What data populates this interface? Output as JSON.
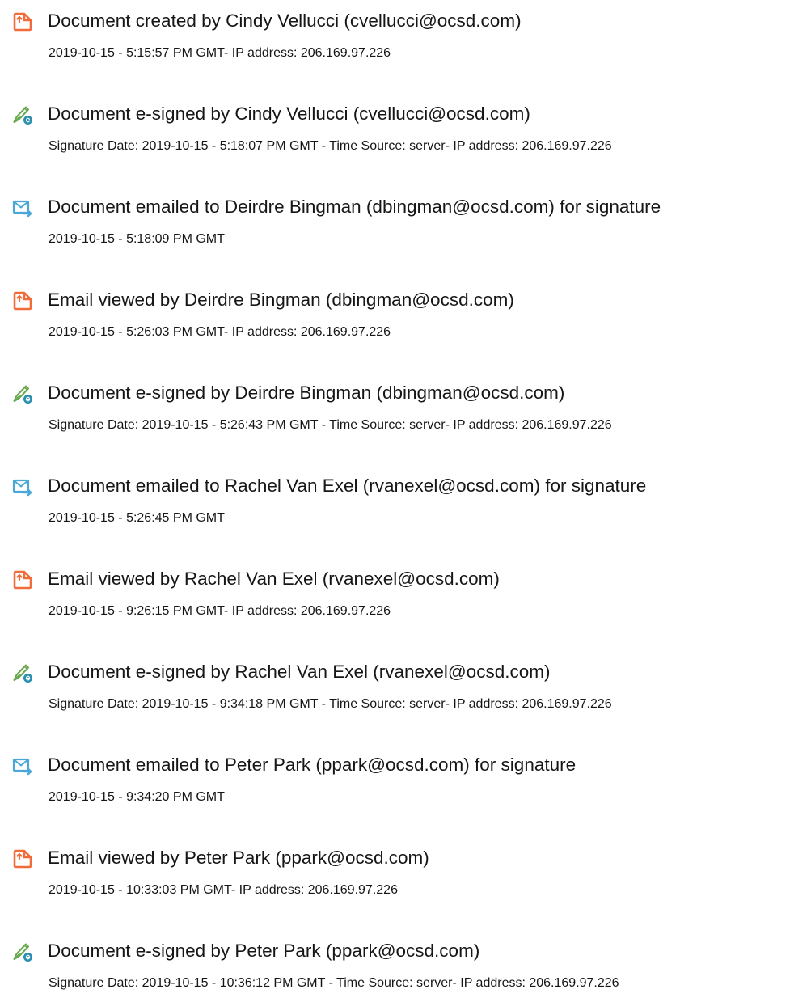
{
  "events": [
    {
      "type": "created",
      "icon": "document-created-icon",
      "title": "Document created by Cindy Vellucci (cvellucci@ocsd.com)",
      "detail": "2019-10-15 - 5:15:57 PM GMT- IP address: 206.169.97.226"
    },
    {
      "type": "signed",
      "icon": "e-sign-pen-icon",
      "title": "Document e-signed by Cindy Vellucci (cvellucci@ocsd.com)",
      "detail": "Signature Date: 2019-10-15 - 5:18:07 PM GMT - Time Source: server- IP address: 206.169.97.226"
    },
    {
      "type": "emailed",
      "icon": "envelope-send-icon",
      "title": "Document emailed to Deirdre Bingman (dbingman@ocsd.com) for signature",
      "detail": "2019-10-15 - 5:18:09 PM GMT"
    },
    {
      "type": "viewed",
      "icon": "document-viewed-icon",
      "title": "Email viewed by Deirdre Bingman (dbingman@ocsd.com)",
      "detail": "2019-10-15 - 5:26:03 PM GMT- IP address: 206.169.97.226"
    },
    {
      "type": "signed",
      "icon": "e-sign-pen-icon",
      "title": "Document e-signed by Deirdre Bingman (dbingman@ocsd.com)",
      "detail": "Signature Date: 2019-10-15 - 5:26:43 PM GMT - Time Source: server- IP address: 206.169.97.226"
    },
    {
      "type": "emailed",
      "icon": "envelope-send-icon",
      "title": "Document emailed to Rachel Van Exel (rvanexel@ocsd.com) for signature",
      "detail": "2019-10-15 - 5:26:45 PM GMT"
    },
    {
      "type": "viewed",
      "icon": "document-viewed-icon",
      "title": "Email viewed by Rachel Van Exel (rvanexel@ocsd.com)",
      "detail": "2019-10-15 - 9:26:15 PM GMT- IP address: 206.169.97.226"
    },
    {
      "type": "signed",
      "icon": "e-sign-pen-icon",
      "title": "Document e-signed by Rachel Van Exel (rvanexel@ocsd.com)",
      "detail": "Signature Date: 2019-10-15 - 9:34:18 PM GMT - Time Source: server- IP address: 206.169.97.226"
    },
    {
      "type": "emailed",
      "icon": "envelope-send-icon",
      "title": "Document emailed to Peter Park (ppark@ocsd.com) for signature",
      "detail": "2019-10-15 - 9:34:20 PM GMT"
    },
    {
      "type": "viewed",
      "icon": "document-viewed-icon",
      "title": "Email viewed by Peter Park (ppark@ocsd.com)",
      "detail": "2019-10-15 - 10:33:03 PM GMT- IP address: 206.169.97.226"
    },
    {
      "type": "signed",
      "icon": "e-sign-pen-icon",
      "title": "Document e-signed by Peter Park (ppark@ocsd.com)",
      "detail": "Signature Date: 2019-10-15 - 10:36:12 PM GMT - Time Source: server- IP address: 206.169.97.226"
    }
  ],
  "colors": {
    "created_icon": "#f26b3a",
    "signed_icon_pen": "#6aa84f",
    "signed_icon_badge": "#2b8fb0",
    "emailed_icon": "#4aa8d8",
    "text": "#161616"
  }
}
